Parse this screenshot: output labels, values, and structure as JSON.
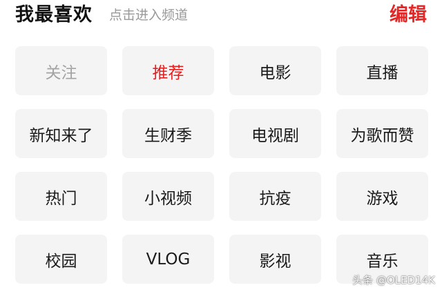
{
  "header": {
    "title": "我最喜欢",
    "subtitle": "点击进入频道",
    "edit_label": "编辑"
  },
  "channels": [
    {
      "label": "关注",
      "state": "disabled"
    },
    {
      "label": "推荐",
      "state": "active"
    },
    {
      "label": "电影",
      "state": "normal"
    },
    {
      "label": "直播",
      "state": "normal"
    },
    {
      "label": "新知来了",
      "state": "normal"
    },
    {
      "label": "生财季",
      "state": "normal"
    },
    {
      "label": "电视剧",
      "state": "normal"
    },
    {
      "label": "为歌而赞",
      "state": "normal"
    },
    {
      "label": "热门",
      "state": "normal"
    },
    {
      "label": "小视频",
      "state": "normal"
    },
    {
      "label": "抗疫",
      "state": "normal"
    },
    {
      "label": "游戏",
      "state": "normal"
    },
    {
      "label": "校园",
      "state": "normal"
    },
    {
      "label": "VLOG",
      "state": "normal"
    },
    {
      "label": "影视",
      "state": "normal"
    },
    {
      "label": "音乐",
      "state": "normal"
    }
  ],
  "watermark": "头条 @OLED14K",
  "colors": {
    "accent": "#e02020",
    "chip_bg": "#f4f4f4",
    "muted": "#999999"
  }
}
